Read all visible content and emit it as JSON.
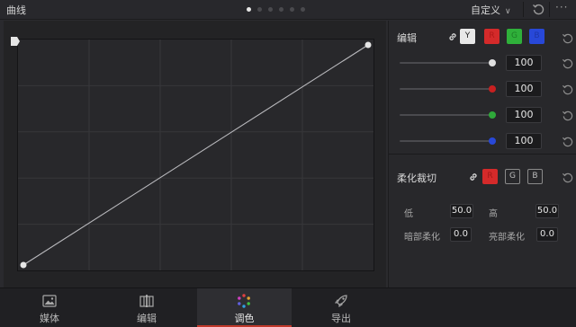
{
  "header": {
    "title": "曲线",
    "page_dots": 6,
    "active_dot": 0,
    "preset_label": "自定义"
  },
  "curve": {
    "points": [
      {
        "x": 0,
        "y": 0
      },
      {
        "x": 1,
        "y": 1
      }
    ]
  },
  "edit": {
    "label": "编辑",
    "channels": [
      {
        "label": "Y",
        "color": "#e8e8e8",
        "text_color": "#222222"
      },
      {
        "label": "R",
        "color": "#d42a2a",
        "text_color": "#b01818"
      },
      {
        "label": "G",
        "color": "#2fb03a",
        "text_color": "#1d7e26"
      },
      {
        "label": "B",
        "color": "#2848d8",
        "text_color": "#1e36a8"
      }
    ],
    "sliders": [
      {
        "value": "100",
        "level": 1.0,
        "knob_color": "#e0e0e0"
      },
      {
        "value": "100",
        "level": 1.0,
        "knob_color": "#c82020"
      },
      {
        "value": "100",
        "level": 1.0,
        "knob_color": "#2fa83a"
      },
      {
        "value": "100",
        "level": 1.0,
        "knob_color": "#2848d8"
      }
    ]
  },
  "soft_clip": {
    "label": "柔化裁切",
    "channels": [
      {
        "label": "R",
        "active": true
      },
      {
        "label": "G",
        "active": false
      },
      {
        "label": "B",
        "active": false
      }
    ],
    "low_label": "低",
    "low_value": "50.0",
    "high_label": "高",
    "high_value": "50.0",
    "low_soft_label": "暗部柔化",
    "low_soft_value": "0.0",
    "high_soft_label": "亮部柔化",
    "high_soft_value": "0.0"
  },
  "nav": {
    "items": [
      {
        "label": "媒体",
        "icon": "media-icon",
        "active": false
      },
      {
        "label": "编辑",
        "icon": "edit-page-icon",
        "active": false
      },
      {
        "label": "调色",
        "icon": "color-icon",
        "active": true
      },
      {
        "label": "导出",
        "icon": "deliver-icon",
        "active": false
      }
    ]
  },
  "colors": {
    "accent": "#c0392b",
    "background": "#2a2a2e"
  }
}
